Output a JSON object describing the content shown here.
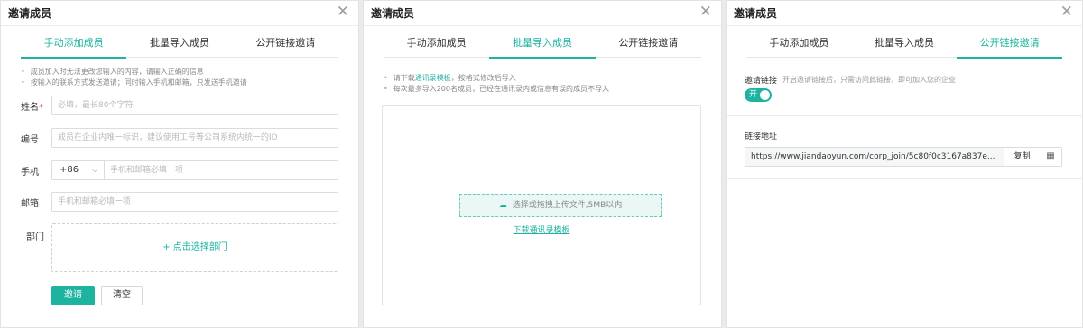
{
  "dialog": {
    "title": "邀请成员",
    "close_glyph": "✕"
  },
  "tabs": [
    "手动添加成员",
    "批量导入成员",
    "公开链接邀请"
  ],
  "manual": {
    "tips": [
      "成员加入时无法更改您输入的内容，请输入正确的信息",
      "按输入的联系方式发送邀请；同时输入手机和邮箱，只发送手机邀请"
    ],
    "name_label": "姓名",
    "name_required": "*",
    "name_placeholder": "必填，最长80个字符",
    "id_label": "编号",
    "id_placeholder": "成员在企业内唯一标识，建议使用工号等公司系统内统一的ID",
    "phone_label": "手机",
    "country_code": "+86",
    "phone_placeholder": "手机和邮箱必填一项",
    "email_label": "邮箱",
    "email_placeholder": "手机和邮箱必填一项",
    "dept_label": "部门",
    "dept_select": "+ 点击选择部门",
    "invite_button": "邀请",
    "clear_button": "清空"
  },
  "batch": {
    "tip1_prefix": "请下载",
    "tip1_link": "通讯录模板",
    "tip1_suffix": "，按格式修改后导入",
    "tip2": "每次最多导入200名成员，已经在通讯录内或信息有误的成员不导入",
    "upload_text": "选择或拖拽上传文件,5MB以内",
    "download_link": "下载通讯录模板"
  },
  "link": {
    "invite_link_label": "邀请链接",
    "invite_link_hint": "开启邀请链接后，只需访问此链接，即可加入您的企业",
    "toggle_text": "开",
    "toggle_on": true,
    "address_label": "链接地址",
    "url": "https://www.jiandaoyun.com/corp_join/5c80f0c3167a837e...",
    "copy_button": "复制"
  },
  "colors": {
    "accent": "#1cb39f",
    "required": "#e84a4a"
  },
  "icons": {
    "close": "close-icon",
    "upload": "upload-cloud-icon",
    "qr": "qr-code-icon",
    "chevron": "chevron-down-icon"
  }
}
